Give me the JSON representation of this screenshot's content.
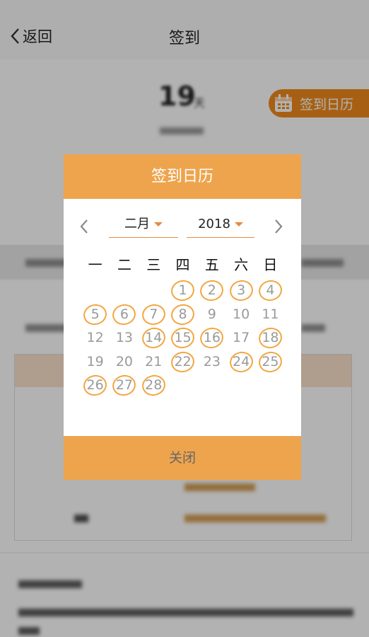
{
  "nav": {
    "back_label": "返回",
    "title": "签到"
  },
  "hero": {
    "count": "19",
    "unit": "天",
    "calendar_tag_label": "签到日历"
  },
  "modal": {
    "title": "签到日历",
    "month": "二月",
    "year": "2018",
    "weekdays": [
      "一",
      "二",
      "三",
      "四",
      "五",
      "六",
      "日"
    ],
    "leading_blanks": 3,
    "days": [
      {
        "d": "1",
        "signed": true
      },
      {
        "d": "2",
        "signed": true
      },
      {
        "d": "3",
        "signed": true
      },
      {
        "d": "4",
        "signed": true
      },
      {
        "d": "5",
        "signed": true
      },
      {
        "d": "6",
        "signed": true
      },
      {
        "d": "7",
        "signed": true
      },
      {
        "d": "8",
        "signed": true
      },
      {
        "d": "9",
        "signed": false
      },
      {
        "d": "10",
        "signed": false
      },
      {
        "d": "11",
        "signed": false
      },
      {
        "d": "12",
        "signed": false
      },
      {
        "d": "13",
        "signed": false
      },
      {
        "d": "14",
        "signed": true
      },
      {
        "d": "15",
        "signed": true
      },
      {
        "d": "16",
        "signed": true
      },
      {
        "d": "17",
        "signed": false
      },
      {
        "d": "18",
        "signed": true
      },
      {
        "d": "19",
        "signed": false
      },
      {
        "d": "20",
        "signed": false
      },
      {
        "d": "21",
        "signed": false
      },
      {
        "d": "22",
        "signed": true
      },
      {
        "d": "23",
        "signed": false
      },
      {
        "d": "24",
        "signed": true
      },
      {
        "d": "25",
        "signed": true
      },
      {
        "d": "26",
        "signed": true
      },
      {
        "d": "27",
        "signed": true
      },
      {
        "d": "28",
        "signed": true
      }
    ],
    "close_label": "关闭"
  },
  "colors": {
    "accent": "#eea44d",
    "tag_orange": "#ef8a1c",
    "circle": "#f2a640"
  },
  "icons": [
    "chevron-left-icon",
    "calendar-icon",
    "chevron-right-icon",
    "caret-down-icon"
  ]
}
